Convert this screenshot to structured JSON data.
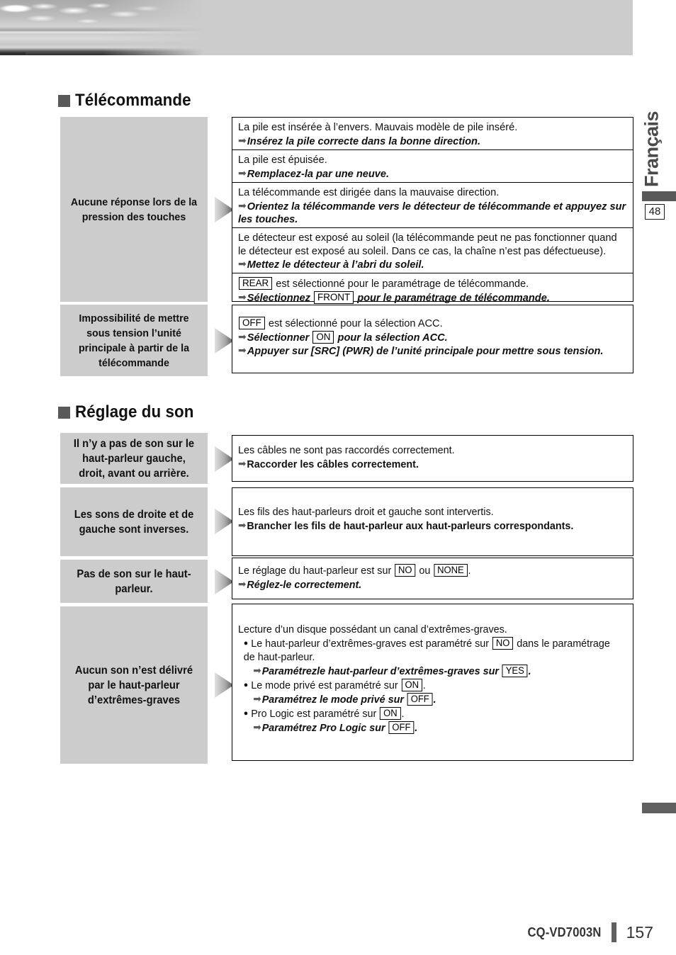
{
  "header": {
    "photo_alt": "seascape-photo"
  },
  "side": {
    "language": "Français",
    "chapter_number": "48"
  },
  "footer": {
    "model": "CQ-VD7003N",
    "page": "157"
  },
  "sections": [
    {
      "id": "remote",
      "title": "Télécommande",
      "rows": [
        {
          "symptom": "Aucune réponse lors de la pression des touches",
          "items": [
            {
              "cause": "La pile est insérée à l’envers. Mauvais modèle de pile inséré.",
              "fix": "Insérez la pile correcte dans la bonne direction."
            },
            {
              "cause": "La pile est épuisée.",
              "fix": "Remplacez-la par une neuve."
            },
            {
              "cause": "La télécommande est dirigée dans la mauvaise direction.",
              "fix": "Orientez la télécommande vers le détecteur de télécommande et appuyez sur les touches."
            },
            {
              "cause": "Le détecteur est exposé au soleil (la télécommande peut ne pas fonctionner quand le détecteur est exposé au soleil. Dans ce cas, la chaîne n’est pas défectueuse).",
              "fix": "Mettez le détecteur à l’abri du soleil."
            },
            {
              "cause_token": "REAR",
              "cause_after": " est sélectionné pour le paramétrage de télécommande.",
              "fix_before": "Sélectionnez",
              "fix_token": "FRONT",
              "fix_after": "pour le paramétrage de télécommande."
            }
          ]
        },
        {
          "symptom": "Impossibilité de mettre sous tension l’unité principale à partir de la télécommande",
          "items": [
            {
              "cause_token": "OFF",
              "cause_after": " est sélectionné pour la sélection ACC.",
              "fix_before": "Sélectionner",
              "fix_token": "ON",
              "fix_after": "pour la sélection ACC.",
              "fix2": "Appuyer sur [SRC] (PWR) de l’unité principale pour mettre sous tension."
            }
          ]
        }
      ]
    },
    {
      "id": "sound",
      "title": "Réglage du son",
      "rows": [
        {
          "symptom": "Il n’y a pas de son sur le haut-parleur gauche, droit, avant ou arrière.",
          "items": [
            {
              "cause": "Les câbles ne sont pas raccordés correctement.",
              "fix": "Raccorder les câbles correctement."
            }
          ]
        },
        {
          "symptom": "Les sons de droite et de gauche sont inverses.",
          "items": [
            {
              "cause": "Les fils des haut-parleurs droit et gauche sont intervertis.",
              "fix": "Brancher les fils de haut-parleur aux haut-parleurs correspondants."
            }
          ]
        },
        {
          "symptom": "Pas de son sur le haut-parleur.",
          "items": [
            {
              "cause_before": "Le réglage du haut-parleur est sur",
              "cause_token": "NO",
              "cause_mid": "ou",
              "cause_token2": "NONE",
              "cause_after": ".",
              "fix": "Réglez-le correctement."
            }
          ]
        },
        {
          "symptom": "Aucun son n’est délivré par le haut-parleur d’extrêmes-graves",
          "items": [
            {
              "intro": "Lecture d’un disque possédant un canal d’extrêmes-graves.",
              "bullets": [
                {
                  "text_before": "Le haut-parleur d’extrêmes-graves est paramétré sur",
                  "token": "NO",
                  "text_after": "dans le paramétrage de haut-parleur.",
                  "fix_before": "Paramétrezle haut-parleur d’extrêmes-graves sur",
                  "fix_token": "YES",
                  "fix_after": "."
                },
                {
                  "text_before": "Le mode privé est paramétré sur",
                  "token": "ON",
                  "text_after": ".",
                  "fix_before": "Paramétrez le mode privé sur",
                  "fix_token": "OFF",
                  "fix_after": "."
                },
                {
                  "text_before": "Pro Logic est paramétré sur",
                  "token": "ON",
                  "text_after": ".",
                  "fix_before": "Paramétrez Pro Logic sur",
                  "fix_token": "OFF",
                  "fix_after": "."
                }
              ]
            }
          ]
        }
      ]
    }
  ],
  "icons": {
    "arrow": "➡",
    "bullet": "●"
  },
  "colors": {
    "cell_gray": "#cccccc",
    "dark_gray": "#595959",
    "text": "#111111"
  }
}
